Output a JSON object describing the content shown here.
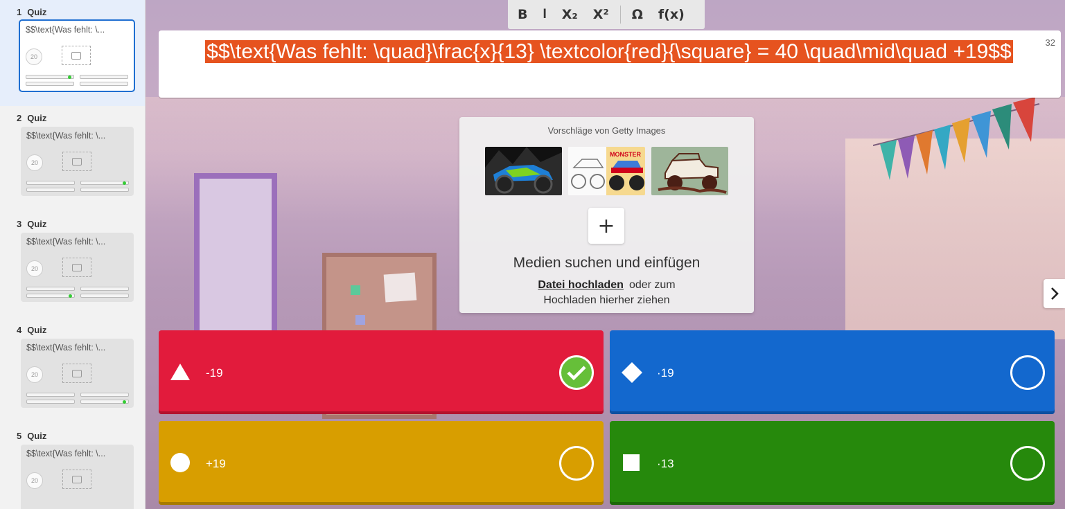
{
  "sidebar": {
    "slides": [
      {
        "number": "1",
        "type": "Quiz",
        "preview_text": "$$\\text{Was fehlt: \\...",
        "time": "20",
        "active": true
      },
      {
        "number": "2",
        "type": "Quiz",
        "preview_text": "$$\\text{Was fehlt: \\...",
        "time": "20",
        "active": false
      },
      {
        "number": "3",
        "type": "Quiz",
        "preview_text": "$$\\text{Was fehlt: \\...",
        "time": "20",
        "active": false
      },
      {
        "number": "4",
        "type": "Quiz",
        "preview_text": "$$\\text{Was fehlt: \\...",
        "time": "20",
        "active": false
      },
      {
        "number": "5",
        "type": "Quiz",
        "preview_text": "$$\\text{Was fehlt: \\...",
        "time": "20",
        "active": false
      }
    ],
    "tools": [
      "duplicate-icon",
      "trash-icon"
    ]
  },
  "toolbar": {
    "bold": "B",
    "italic": "I",
    "subscript": "X₂",
    "superscript": "X²",
    "symbol": "Ω",
    "function": "f(x)"
  },
  "question": {
    "text": "$$\\text{Was fehlt: \\quad}\\frac{x}{13} \\textcolor{red}{\\square} = 40 \\quad\\mid\\quad +19$$",
    "char_remaining": "32"
  },
  "media": {
    "suggestions_title": "Vorschläge von Getty Images",
    "thumbnails": [
      "atv-image",
      "monster-truck-image",
      "jeep-image"
    ],
    "add_label": "+",
    "heading": "Medien suchen und einfügen",
    "upload_link": "Datei hochladen",
    "upload_hint_1": "oder zum",
    "upload_hint_2": "Hochladen hierher ziehen"
  },
  "answers": [
    {
      "shape": "triangle-icon",
      "text": "-19",
      "correct": true,
      "color": "#e21b3c"
    },
    {
      "shape": "diamond-icon",
      "text": "·19",
      "correct": false,
      "color": "#1368ce"
    },
    {
      "shape": "circle-icon",
      "text": "+19",
      "correct": false,
      "color": "#d89e00"
    },
    {
      "shape": "square-icon",
      "text": "·13",
      "correct": false,
      "color": "#26890c"
    }
  ]
}
